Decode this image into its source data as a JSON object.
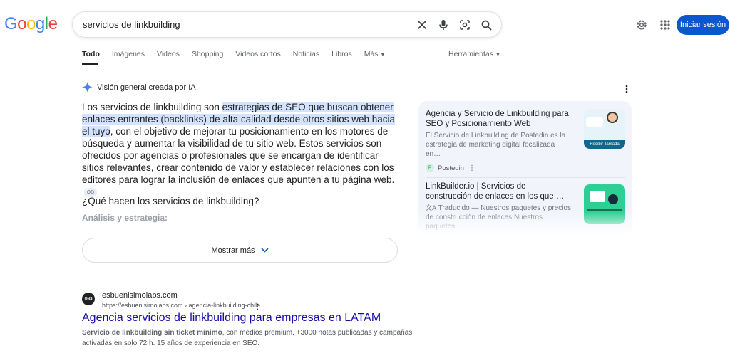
{
  "logo": {
    "text": "Google",
    "colors": [
      "#4285F4",
      "#EA4335",
      "#FBBC05",
      "#4285F4",
      "#34A853",
      "#EA4335"
    ]
  },
  "search": {
    "query": "servicios de linkbuilding"
  },
  "header": {
    "signin_label": "Iniciar sesión"
  },
  "tabs": [
    {
      "label": "Todo",
      "active": true
    },
    {
      "label": "Imágenes"
    },
    {
      "label": "Videos"
    },
    {
      "label": "Shopping"
    },
    {
      "label": "Videos cortos"
    },
    {
      "label": "Noticias"
    },
    {
      "label": "Libros"
    },
    {
      "label": "Más"
    }
  ],
  "tools_label": "Herramientas",
  "ai_overview": {
    "heading": "Visión general creada por IA",
    "text_start": "Los servicios de linkbuilding son ",
    "text_highlight": "estrategias de SEO que buscan obtener enlaces entrantes (backlinks) de alta calidad desde otros sitios web hacia el tuyo",
    "text_rest": ", con el objetivo de mejorar tu posicionamiento en los motores de búsqueda y aumentar la visibilidad de tu sitio web. Estos servicios son ofrecidos por agencias o profesionales que se encargan de identificar sitios relevantes, crear contenido de valor y establecer relaciones con los editores para lograr la inclusión de enlaces que apunten a tu página web.",
    "subheading": "¿Qué hacen los servicios de linkbuilding?",
    "subheading2": "Análisis y estrategia:",
    "show_more": "Mostrar más"
  },
  "sources": [
    {
      "title": "Agencia y Servicio de Linkbuilding para SEO y Posicionamiento Web",
      "description": "El Servicio de Linkbuilding de Postedin es la estrategia de marketing digital focalizada en…",
      "source": "Postedin",
      "thumb_text": "Recibir llamada"
    },
    {
      "title": "LinkBuilder.io | Servicios de construcción de enlaces en los que …",
      "description": "Traducido — Nuestros paquetes y precios de construcción de enlaces Nuestros paquetes…"
    }
  ],
  "result": {
    "site": "esbuenisimolabs.com",
    "url": "https://esbuenisimolabs.com › agencia-linkbuilding-chile",
    "title": "Agencia servicios de linkbuilding para empresas en LATAM",
    "snippet_bold": "Servicio de linkbuilding sin ticket mínimo",
    "snippet_rest": ", con medios premium, +3000 notas publicadas y campañas activadas en solo 72 h. 15 años de experiencia en SEO."
  }
}
